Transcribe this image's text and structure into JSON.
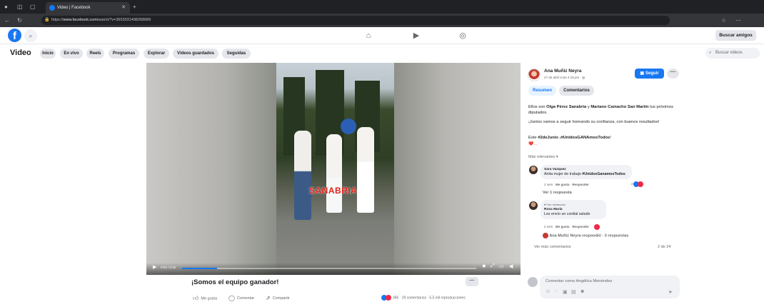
{
  "browser": {
    "tab_title": "Video | Facebook",
    "url_prefix": "https://",
    "url_host": "www.facebook.com",
    "url_path": "/watch/?v=3653031498268689"
  },
  "fb": {
    "logo": "f",
    "buscar_amigos": "Buscar amigos"
  },
  "video_nav": {
    "title": "Video",
    "pills": [
      "Inicio",
      "En vivo",
      "Reels",
      "Programas",
      "Explorar",
      "Videos guardados",
      "Seguidas"
    ],
    "search_placeholder": "Buscar videos"
  },
  "video": {
    "overlay_text": "SANABRIA",
    "time": "0:01 / 0:32",
    "progress": 0.12
  },
  "post": {
    "title": "¡Somos el equipo ganador!",
    "more": "···",
    "actions": [
      "Me gusta",
      "Comentar",
      "Compartir"
    ],
    "stats": "395 · 29 comentarios · 5,5 mil reproducciones"
  },
  "panel": {
    "author": "Ana Muñiz Neyra",
    "time": "27 de abril a las 4:19 pm · ",
    "follow": "Seguir",
    "more": "···",
    "tab_resumen": "Resumen",
    "tab_comentarios": "Comentarios",
    "desc1_a": "Ellos son ",
    "desc1_b": "Olga Pérez Sanabria",
    "desc1_c": " y ",
    "desc1_d": "Mariano Camacho San Martín",
    "desc1_e": " tus próximos diputados.",
    "desc2": "¡Juntos vamos a seguir honrando su confianza, con buenos resultados!",
    "desc3_a": "Este ",
    "desc3_b": "#2deJunio",
    "desc3_c": " ¡",
    "desc3_d": "#UnidosGANAmosTodos",
    "desc3_e": "!",
    "desc4": "❤️...",
    "relevantes": "Más relevantes ▾",
    "comments": [
      {
        "badge": "",
        "name": "Sara Vazquez",
        "text": "Anita mujer de trabajo ",
        "tag": "#UnidosGanamosTodos",
        "meta_time": "2 sem",
        "like": "Me gusta",
        "reply": "Responder",
        "reaction_count": "2",
        "replies": "Ver 1 respuesta"
      },
      {
        "badge": "♥ Fan destacado",
        "name": "Rosa María",
        "text": "Les envío un cordial saludo",
        "tag": "",
        "meta_time": "2 sem",
        "like": "Me gusta",
        "reply": "Responder",
        "reaction_count": "",
        "replies": "Ana Muñiz Neyra respondió · 3 respuestas"
      }
    ],
    "ver_mas": "Ver más comentarios",
    "count": "2 de 24",
    "comment_placeholder": "Comentar como Angélica Menéndez"
  },
  "colors": {
    "fb_blue": "#1877f2",
    "like_blue": "#1877f2",
    "love_red": "#f02849"
  },
  "icons": [
    "home-icon",
    "watch-icon",
    "gaming-icon",
    "search-icon",
    "play-icon",
    "settings-icon",
    "fullscreen-icon",
    "volume-icon",
    "like-icon",
    "comment-icon",
    "share-icon",
    "globe-icon",
    "camera-icon",
    "gif-icon",
    "send-icon"
  ]
}
